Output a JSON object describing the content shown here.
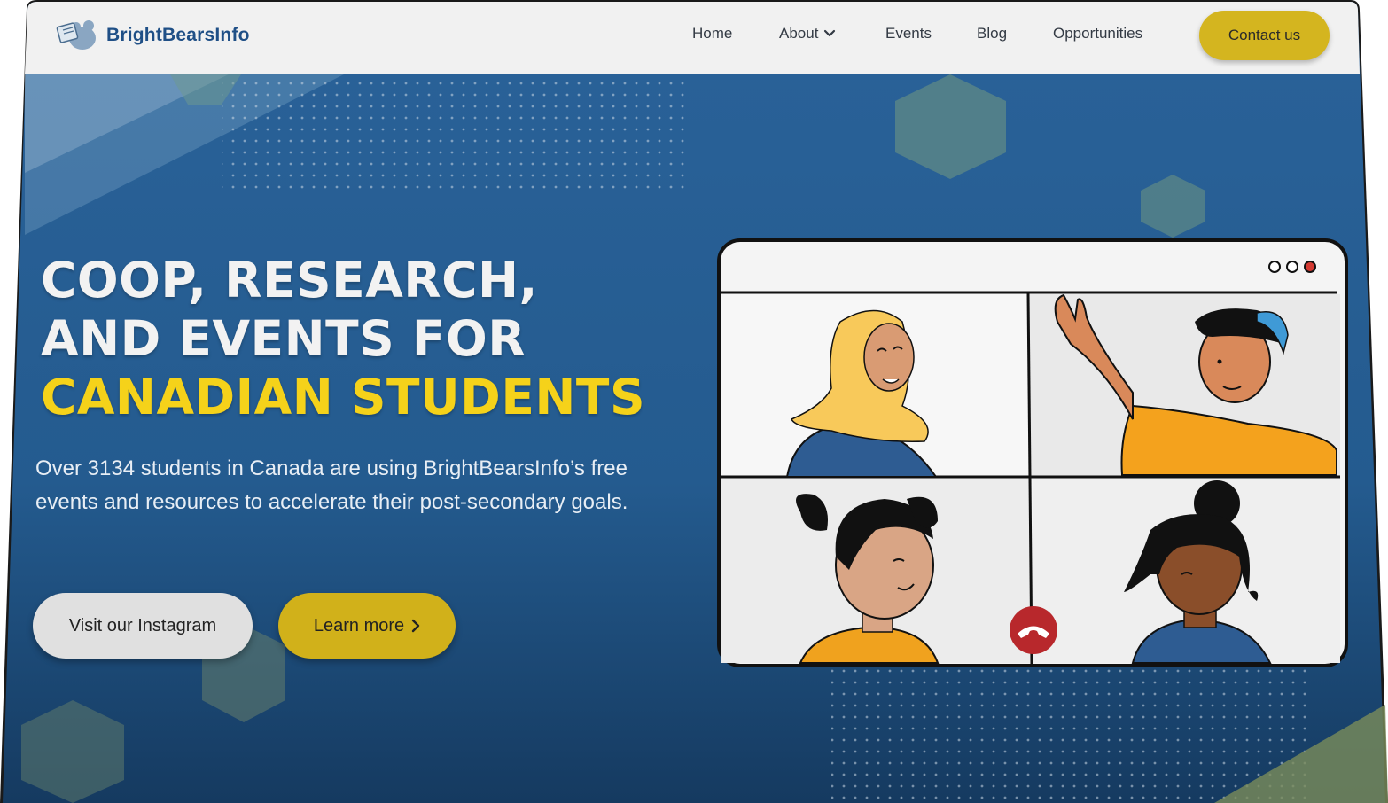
{
  "brand": {
    "name": "BrightBearsInfo"
  },
  "nav": {
    "links": [
      "Home",
      "About",
      "Events",
      "Blog",
      "Opportunities"
    ],
    "contact_label": "Contact us"
  },
  "hero": {
    "headline_line1": "COOP, RESEARCH,",
    "headline_line2": "AND EVENTS FOR",
    "headline_line3": "CANADIAN STUDENTS",
    "subtext": "Over 3134 students in Canada are using BrightBearsInfo’s free events and resources to accelerate their post-secondary goals.",
    "instagram_label": "Visit our Instagram",
    "learn_more_label": "Learn more"
  },
  "icons": {
    "logo": "bear-logo-icon",
    "about_dropdown": "chevron-down-icon",
    "learn_more": "chevron-right-icon",
    "window_controls": "window-dots-icon",
    "end_call": "hang-up-phone-icon"
  },
  "colors": {
    "hero_blue": "#235a8e",
    "accent_yellow": "#f5d21a",
    "button_yellow": "#d1b11a",
    "brand_blue": "#1f4f86",
    "end_call_red": "#b8282c"
  }
}
